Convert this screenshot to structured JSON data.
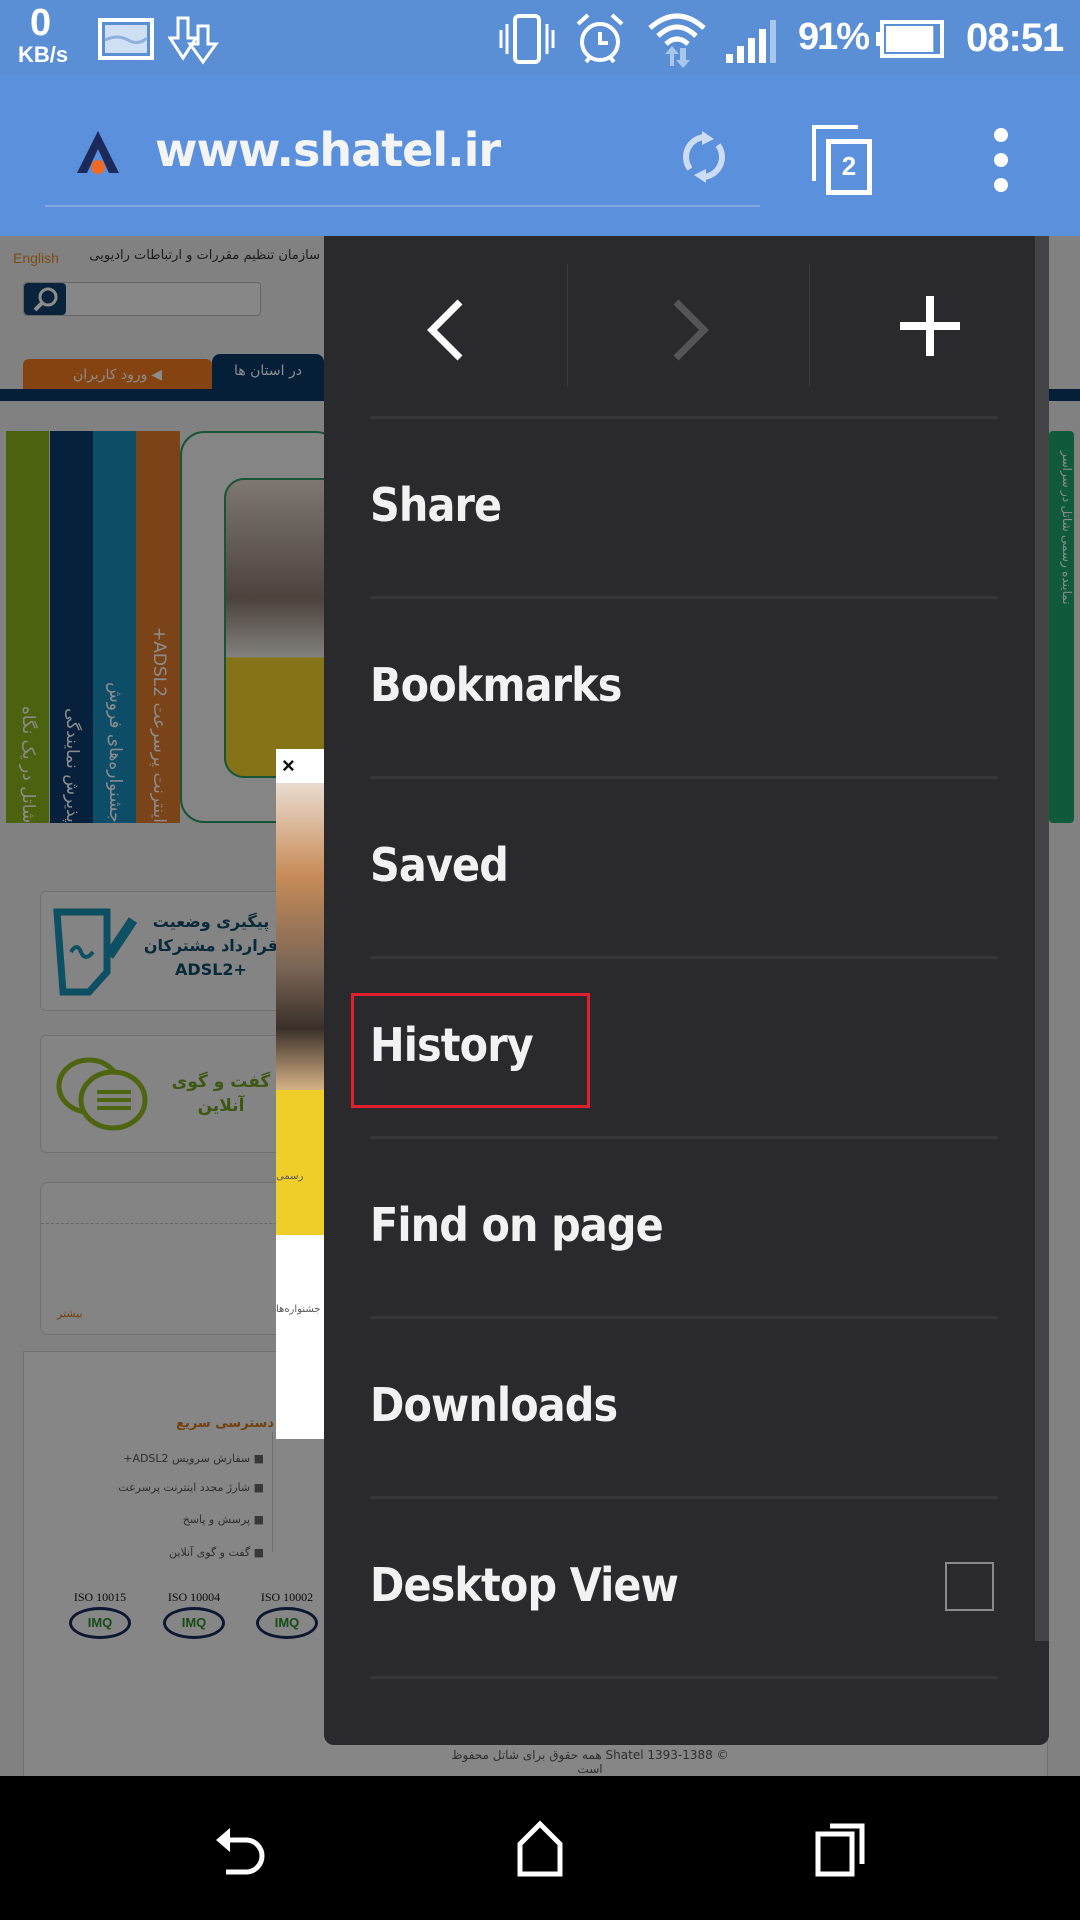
{
  "status_bar": {
    "net_speed_value": "0",
    "net_speed_unit": "KB/s",
    "battery_percent": "91%",
    "battery_level": 0.91,
    "time": "08:51",
    "icons": [
      "gallery-icon",
      "download-icon",
      "vibrate-icon",
      "alarm-icon",
      "wifi-icon",
      "signal-icon",
      "battery-icon"
    ]
  },
  "browser_toolbar": {
    "url": "www.shatel.ir",
    "tab_count": "2",
    "icons": [
      "site-logo-icon",
      "refresh-icon",
      "tabs-icon",
      "overflow-menu-icon"
    ]
  },
  "webpage": {
    "language_link": "English",
    "header_text": "سازمان تنظیم مقررات و ارتباطات رادیویی",
    "search_placeholder": "",
    "login_tab": "ورود کاربران",
    "provinces_tab": "در استان ها",
    "strips": [
      {
        "label": "شاتل در یک نگاه",
        "color": "#8db21c"
      },
      {
        "label": "پذیرش نمایندگی",
        "color": "#0d3d6e"
      },
      {
        "label": "جشنواره‌های فروش",
        "color": "#1a8dbd"
      },
      {
        "label": "اینترنت پرسرعت ADSL2+",
        "color": "#e07b2c"
      }
    ],
    "right_strip_text": "نماینده رسمی شاتل در سراسر",
    "contract_box": {
      "line1": "پیگیری وضعیت",
      "line2": "قرارداد مشترکان",
      "line3": "ADSL2+"
    },
    "chat_box": {
      "line1": "گفت و گوی",
      "line2": "آنلاین"
    },
    "more_link": "بیشتر",
    "quick_access_title": "دسترسی سریع",
    "quick_links": [
      "سفارش سرویس ADSL2+",
      "شارژ مجدد اینترنت پرسرعت",
      "پرسش و پاسخ",
      "گفت و گوی آنلاین"
    ],
    "iso_badges": [
      "ISO 10015",
      "ISO 10004",
      "ISO 10002"
    ],
    "iso_badge_text": "IMQ",
    "popup_close": "×",
    "popup_text1": "رسمی",
    "popup_text2": "جشنواره‌ها",
    "footer": "© Shatel 1393-1388 همه حقوق برای شاتل محفوظ است"
  },
  "menu": {
    "nav": {
      "back": "back-icon",
      "forward": "forward-icon",
      "forward_enabled": false,
      "new_tab": "plus-icon"
    },
    "items": [
      {
        "label": "Share"
      },
      {
        "label": "Bookmarks"
      },
      {
        "label": "Saved"
      },
      {
        "label": "History",
        "highlighted": true
      },
      {
        "label": "Find on page"
      },
      {
        "label": "Downloads"
      },
      {
        "label": "Desktop View",
        "checkbox": true,
        "checked": false
      }
    ],
    "highlight_color": "#e0202e"
  },
  "nav_bar": {
    "icons": [
      "back-icon",
      "home-icon",
      "recent-apps-icon"
    ]
  }
}
